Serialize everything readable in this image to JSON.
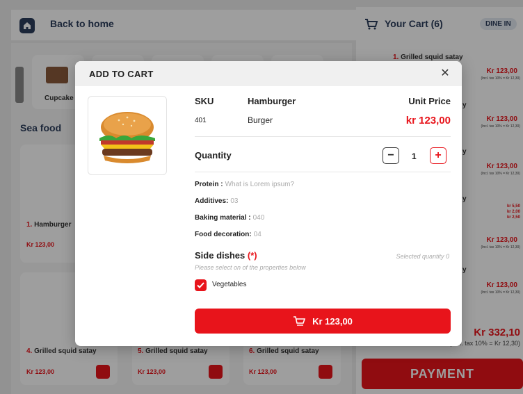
{
  "header": {
    "back_label": "Back to home",
    "cart_title": "Your Cart (6)",
    "dine_mode": "DINE IN"
  },
  "categories": {
    "items": [
      {
        "label": "Cupcake"
      }
    ],
    "section_title": "Sea food"
  },
  "products": [
    {
      "num": "1.",
      "name": "Hamburger",
      "price": "Kr 123,00"
    },
    {
      "num": "4.",
      "name": "Grilled squid satay",
      "price": "Kr 123,00"
    },
    {
      "num": "5.",
      "name": "Grilled squid satay",
      "price": "Kr 123,00"
    },
    {
      "num": "6.",
      "name": "Grilled squid satay",
      "price": "Kr 123,00"
    }
  ],
  "cart": {
    "items": [
      {
        "num": "1.",
        "name": "Grilled squid satay",
        "price": "Kr 123,00",
        "tax": "(Incl. tax 10% = Kr 12,30)"
      },
      {
        "num": "",
        "name": "y",
        "price": "Kr 123,00",
        "tax": "(Incl. tax 10% = Kr 12,30)"
      },
      {
        "num": "",
        "name": "y",
        "price": "Kr 123,00",
        "tax": "(Incl. tax 10% = Kr 12,30)"
      },
      {
        "num": "",
        "name": "y",
        "price": "Kr 123,00",
        "tax": "(Incl. tax 10% = Kr 12,30)",
        "extras": [
          "kr 5,50",
          "kr 2,00",
          "kr 2,50"
        ]
      },
      {
        "num": "",
        "name": "y",
        "price": "Kr 123,00",
        "tax": "(Incl. tax 10% = Kr 12,30)"
      }
    ],
    "total": "Kr 332,10",
    "total_tax": "(Incl. tax 10% = Kr 12,30)",
    "payment_label": "PAYMENT"
  },
  "modal": {
    "title": "ADD TO CART",
    "sku_header": "SKU",
    "name_header": "Hamburger",
    "unit_price_header": "Unit Price",
    "sku_value": "401",
    "name_value": "Burger",
    "unit_price": "kr 123,00",
    "quantity_label": "Quantity",
    "quantity": "1",
    "minus_symbol": "−",
    "plus_symbol": "+",
    "properties": [
      {
        "label": "Protein :",
        "value": "What is Lorem ipsum?"
      },
      {
        "label": "Additives:",
        "value": "03"
      },
      {
        "label": "Baking material :",
        "value": "040"
      },
      {
        "label": "Food decoration:",
        "value": "04"
      }
    ],
    "side_dishes_title": "Side dishes",
    "side_dishes_required": "(*)",
    "side_dishes_hint": "Please select on of the properties below",
    "selected_quantity": "Selected quantity 0",
    "option_label": "Vegetables",
    "add_button_label": "Kr 123,00"
  },
  "colors": {
    "accent": "#e8141b",
    "navy": "#2d3e5c"
  }
}
